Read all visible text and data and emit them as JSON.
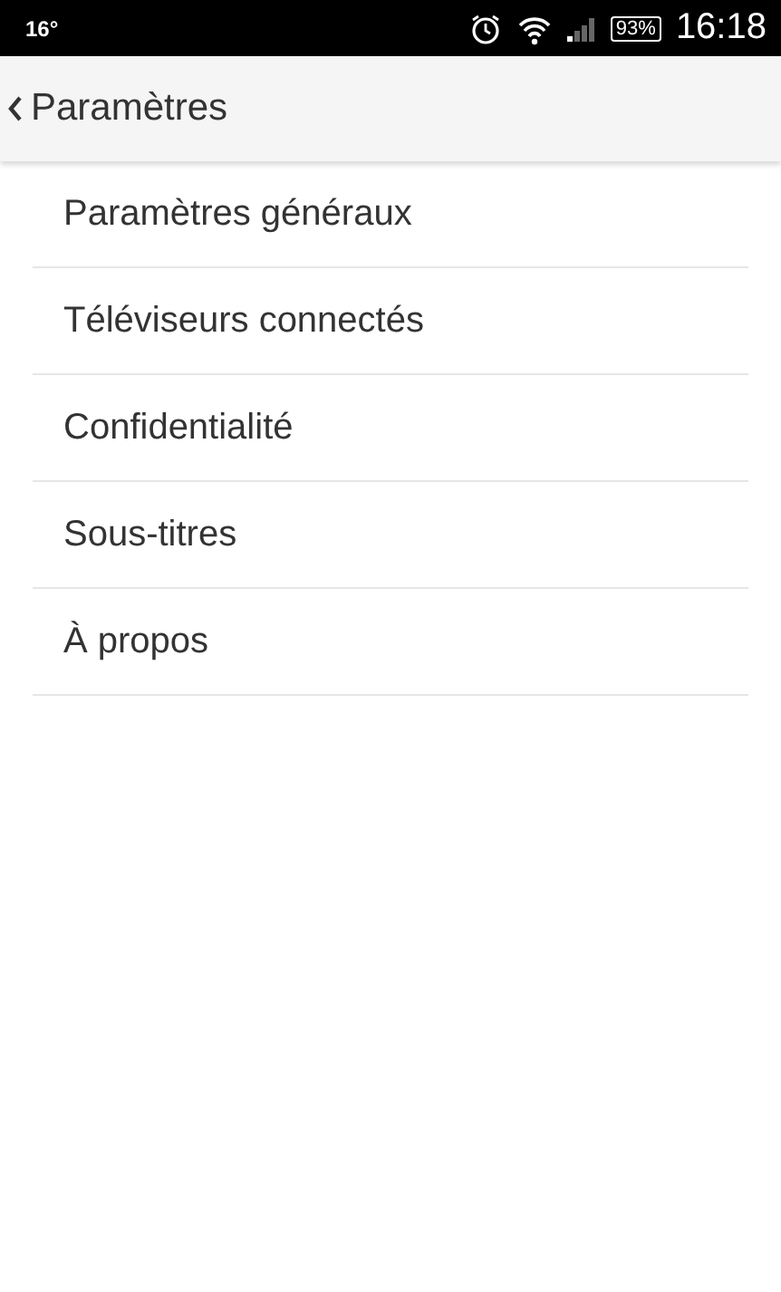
{
  "status_bar": {
    "temperature": "16°",
    "battery": "93%",
    "time": "16:18"
  },
  "header": {
    "title": "Paramètres"
  },
  "items": [
    {
      "label": "Paramètres généraux"
    },
    {
      "label": "Téléviseurs connectés"
    },
    {
      "label": "Confidentialité"
    },
    {
      "label": "Sous-titres"
    },
    {
      "label": "À propos"
    }
  ]
}
